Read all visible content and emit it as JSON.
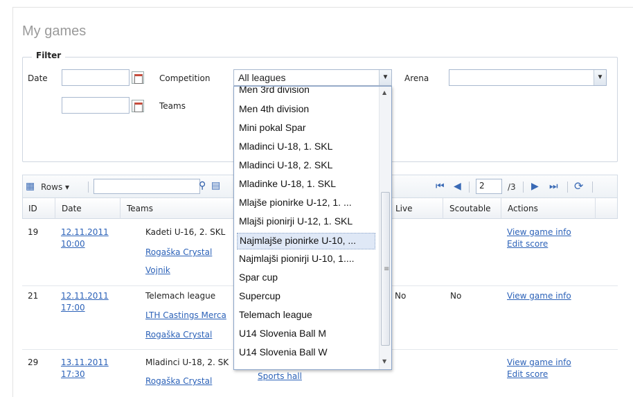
{
  "page": {
    "title": "My games"
  },
  "filter": {
    "legend": "Filter",
    "date_label": "Date",
    "competition_label": "Competition",
    "competition_value": "All leagues",
    "arena_label": "Arena",
    "teams_label": "Teams"
  },
  "toolbar": {
    "rows_label": "Rows",
    "page_current": "2",
    "page_total": "/3"
  },
  "grid": {
    "columns": [
      "ID",
      "Date",
      "Teams",
      "Live",
      "Scoutable",
      "Actions"
    ],
    "rows": [
      {
        "id": "19",
        "date": "12.11.2011",
        "time": "10:00",
        "competition": "Kadeti U-16, 2. SKL",
        "team_home": "Rogaška Crystal",
        "team_away": "Vojnik",
        "live": "",
        "scoutable": "",
        "actions": [
          "View game info",
          "Edit score"
        ]
      },
      {
        "id": "21",
        "date": "12.11.2011",
        "time": "17:00",
        "competition": "Telemach league",
        "team_home": "LTH Castings Merca",
        "team_away": "Rogaška Crystal",
        "live": "No",
        "scoutable": "No",
        "actions": [
          "View game info"
        ]
      },
      {
        "id": "29",
        "date": "13.11.2011",
        "time": "17:30",
        "competition": "Mladinci U-18, 2. SK",
        "team_home": "Rogaška Crystal",
        "arena": "Sports hall",
        "live": "",
        "scoutable": "",
        "actions": [
          "View game info",
          "Edit score"
        ]
      }
    ]
  },
  "dropdown": {
    "items": [
      "Men 3rd division",
      "Men 4th division",
      "Mini pokal Spar",
      "Mladinci U-18, 1. SKL",
      "Mladinci U-18, 2. SKL",
      "Mladinke U-18, 1. SKL",
      "Mlajše pionirke U-12, 1. ...",
      "Mlajši pionirji U-12, 1. SKL",
      "Najmlajše pionirke U-10, ...",
      "Najmlajši pionirji U-10, 1....",
      "Spar cup",
      "Supercup",
      "Telemach league",
      "U14 Slovenia Ball M",
      "U14 Slovenia Ball W"
    ],
    "selected_index": 8
  },
  "icons": {
    "calendar": "calendar-icon",
    "search": "search-icon",
    "first": "first-page-icon",
    "prev": "prev-page-icon",
    "next": "next-page-icon",
    "last": "last-page-icon",
    "refresh": "refresh-icon"
  }
}
